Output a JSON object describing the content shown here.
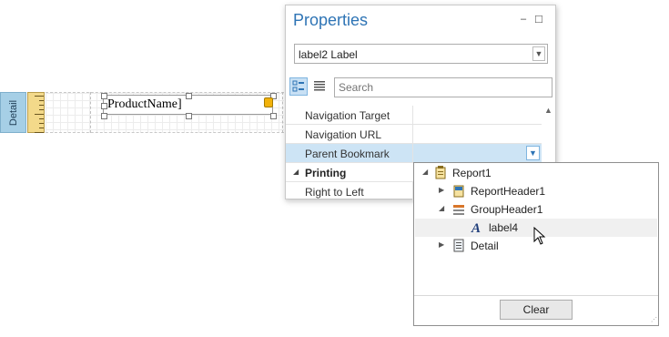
{
  "designer": {
    "band_label": "Detail",
    "label_text": "ProductName]"
  },
  "properties": {
    "title": "Properties",
    "minimize_glyph": "–",
    "maximize_glyph": "□",
    "selected_component": "label2  Label",
    "search_placeholder": "Search",
    "rows": [
      {
        "name": "Navigation Target"
      },
      {
        "name": "Navigation URL"
      },
      {
        "name": "Parent Bookmark",
        "selected": true
      },
      {
        "name": "Printing",
        "category": true
      },
      {
        "name": "Right to Left"
      }
    ]
  },
  "bookmark_popup": {
    "items": [
      {
        "label": "Report1",
        "icon": "report-icon",
        "expander": "expanded"
      },
      {
        "label": "ReportHeader1",
        "icon": "report-header-icon",
        "expander": "collapsed"
      },
      {
        "label": "GroupHeader1",
        "icon": "group-header-icon",
        "expander": "expanded"
      },
      {
        "label": "label4",
        "icon": "label-icon",
        "expander": "none",
        "hovered": true
      },
      {
        "label": "Detail",
        "icon": "detail-band-icon",
        "expander": "collapsed"
      }
    ],
    "clear_label": "Clear"
  },
  "colors": {
    "accent": "#2e74b5",
    "selected_row": "#cde4f5",
    "band_tab": "#a6cfe6",
    "ruler": "#f3d98a"
  }
}
